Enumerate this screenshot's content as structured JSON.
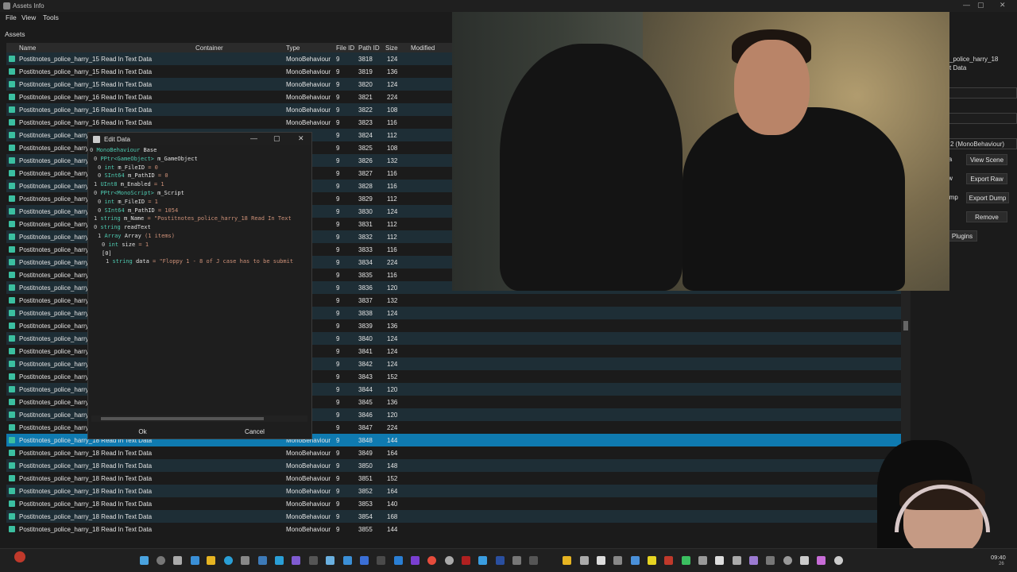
{
  "window": {
    "title": "Assets Info",
    "controls": [
      "—",
      "▢",
      "✕"
    ]
  },
  "menu": [
    "File",
    "View",
    "Tools"
  ],
  "assets_label": "Assets",
  "columns": {
    "name": "Name",
    "container": "Container",
    "type": "Type",
    "file_id": "File ID",
    "path_id": "Path ID",
    "size": "Size",
    "modified": "Modified"
  },
  "rows": [
    {
      "name": "Postitnotes_police_harry_15 Read In Text Data",
      "type": "MonoBehaviour",
      "file_id": "9",
      "path_id": "3818",
      "size": "124"
    },
    {
      "name": "Postitnotes_police_harry_15 Read In Text Data",
      "type": "MonoBehaviour",
      "file_id": "9",
      "path_id": "3819",
      "size": "136"
    },
    {
      "name": "Postitnotes_police_harry_15 Read In Text Data",
      "type": "MonoBehaviour",
      "file_id": "9",
      "path_id": "3820",
      "size": "124"
    },
    {
      "name": "Postitnotes_police_harry_16 Read In Text Data",
      "type": "MonoBehaviour",
      "file_id": "9",
      "path_id": "3821",
      "size": "224"
    },
    {
      "name": "Postitnotes_police_harry_16 Read In Text Data",
      "type": "MonoBehaviour",
      "file_id": "9",
      "path_id": "3822",
      "size": "108"
    },
    {
      "name": "Postitnotes_police_harry_16 Read In Text Data",
      "type": "MonoBehaviour",
      "file_id": "9",
      "path_id": "3823",
      "size": "116"
    },
    {
      "name": "Postitnotes_police_harry",
      "type": "aviour",
      "file_id": "9",
      "path_id": "3824",
      "size": "112"
    },
    {
      "name": "Postitnotes_police_harry",
      "type": "aviour",
      "file_id": "9",
      "path_id": "3825",
      "size": "108"
    },
    {
      "name": "Postitnotes_police_harry",
      "type": "haviour",
      "file_id": "9",
      "path_id": "3826",
      "size": "132"
    },
    {
      "name": "Postitnotes_police_harry",
      "type": "haviour",
      "file_id": "9",
      "path_id": "3827",
      "size": "116"
    },
    {
      "name": "Postitnotes_police_harry",
      "type": "haviour",
      "file_id": "9",
      "path_id": "3828",
      "size": "116"
    },
    {
      "name": "Postitnotes_police_harry",
      "type": "aviour",
      "file_id": "9",
      "path_id": "3829",
      "size": "112"
    },
    {
      "name": "Postitnotes_police_harry",
      "type": "haviour",
      "file_id": "9",
      "path_id": "3830",
      "size": "124"
    },
    {
      "name": "Postitnotes_police_harry",
      "type": "aviour",
      "file_id": "9",
      "path_id": "3831",
      "size": "112"
    },
    {
      "name": "Postitnotes_police_harry",
      "type": "haviour",
      "file_id": "9",
      "path_id": "3832",
      "size": "112"
    },
    {
      "name": "Postitnotes_police_harry",
      "type": "aviour",
      "file_id": "9",
      "path_id": "3833",
      "size": "116"
    },
    {
      "name": "Postitnotes_police_harry",
      "type": "aviour",
      "file_id": "9",
      "path_id": "3834",
      "size": "224"
    },
    {
      "name": "Postitnotes_police_harry",
      "type": "haviour",
      "file_id": "9",
      "path_id": "3835",
      "size": "116"
    },
    {
      "name": "Postitnotes_police_harry",
      "type": "haviour",
      "file_id": "9",
      "path_id": "3836",
      "size": "120"
    },
    {
      "name": "Postitnotes_police_harry",
      "type": "aviour",
      "file_id": "9",
      "path_id": "3837",
      "size": "132"
    },
    {
      "name": "Postitnotes_police_harry",
      "type": "haviour",
      "file_id": "9",
      "path_id": "3838",
      "size": "124"
    },
    {
      "name": "Postitnotes_police_harry",
      "type": "haviour",
      "file_id": "9",
      "path_id": "3839",
      "size": "136"
    },
    {
      "name": "Postitnotes_police_harry",
      "type": "haviour",
      "file_id": "9",
      "path_id": "3840",
      "size": "124"
    },
    {
      "name": "Postitnotes_police_harry",
      "type": "haviour",
      "file_id": "9",
      "path_id": "3841",
      "size": "124"
    },
    {
      "name": "Postitnotes_police_harry",
      "type": "haviour",
      "file_id": "9",
      "path_id": "3842",
      "size": "124"
    },
    {
      "name": "Postitnotes_police_harry",
      "type": "aviour",
      "file_id": "9",
      "path_id": "3843",
      "size": "152"
    },
    {
      "name": "Postitnotes_police_harry",
      "type": "haviour",
      "file_id": "9",
      "path_id": "3844",
      "size": "120"
    },
    {
      "name": "Postitnotes_police_harry",
      "type": "aviour",
      "file_id": "9",
      "path_id": "3845",
      "size": "136"
    },
    {
      "name": "Postitnotes_police_harry",
      "type": "haviour",
      "file_id": "9",
      "path_id": "3846",
      "size": "120"
    },
    {
      "name": "Postitnotes_police_harry",
      "type": "aviour",
      "file_id": "9",
      "path_id": "3847",
      "size": "224"
    },
    {
      "name": "Postitnotes_police_harry_18 Read In Text Data",
      "type": "MonoBehaviour",
      "file_id": "9",
      "path_id": "3848",
      "size": "144"
    },
    {
      "name": "Postitnotes_police_harry_18 Read In Text Data",
      "type": "MonoBehaviour",
      "file_id": "9",
      "path_id": "3849",
      "size": "164"
    },
    {
      "name": "Postitnotes_police_harry_18 Read In Text Data",
      "type": "MonoBehaviour",
      "file_id": "9",
      "path_id": "3850",
      "size": "148"
    },
    {
      "name": "Postitnotes_police_harry_18 Read In Text Data",
      "type": "MonoBehaviour",
      "file_id": "9",
      "path_id": "3851",
      "size": "152"
    },
    {
      "name": "Postitnotes_police_harry_18 Read In Text Data",
      "type": "MonoBehaviour",
      "file_id": "9",
      "path_id": "3852",
      "size": "164"
    },
    {
      "name": "Postitnotes_police_harry_18 Read In Text Data",
      "type": "MonoBehaviour",
      "file_id": "9",
      "path_id": "3853",
      "size": "140"
    },
    {
      "name": "Postitnotes_police_harry_18 Read In Text Data",
      "type": "MonoBehaviour",
      "file_id": "9",
      "path_id": "3854",
      "size": "168"
    },
    {
      "name": "Postitnotes_police_harry_18 Read In Text Data",
      "type": "MonoBehaviour",
      "file_id": "9",
      "path_id": "3855",
      "size": "144"
    }
  ],
  "selected_row": 30,
  "right_panel": {
    "name_field": "_police_harry_18",
    "name_field2": "t Data",
    "type_field": "2 (MonoBehaviour)",
    "buttons": {
      "view_scene": "View Scene",
      "export_raw": "Export Raw",
      "export_raw_clipped": "w",
      "export_dump": "Export Dump",
      "export_dump_clipped": "ump",
      "remove": "Remove",
      "plugins": "Plugins"
    }
  },
  "dialog": {
    "title": "Edit Data",
    "controls": [
      "—",
      "▢",
      "✕"
    ],
    "tree": [
      {
        "indent": 0,
        "flag": "0",
        "type": "MonoBehaviour",
        "name": "Base",
        "value": ""
      },
      {
        "indent": 1,
        "flag": "0",
        "type": "PPtr<GameObject>",
        "name": "m_GameObject",
        "value": ""
      },
      {
        "indent": 2,
        "flag": "0",
        "type": "int",
        "name": "m_FileID",
        "value": " = 0"
      },
      {
        "indent": 2,
        "flag": "0",
        "type": "SInt64",
        "name": "m_PathID",
        "value": " = 0"
      },
      {
        "indent": 1,
        "flag": "1",
        "type": "UInt8",
        "name": "m_Enabled",
        "value": " = 1"
      },
      {
        "indent": 1,
        "flag": "0",
        "type": "PPtr<MonoScript>",
        "name": "m_Script",
        "value": ""
      },
      {
        "indent": 2,
        "flag": "0",
        "type": "int",
        "name": "m_FileID",
        "value": " = 1"
      },
      {
        "indent": 2,
        "flag": "0",
        "type": "SInt64",
        "name": "m_PathID",
        "value": " = 1054"
      },
      {
        "indent": 1,
        "flag": "1",
        "type": "string",
        "name": "m_Name",
        "value": " = \"Postitnotes_police_harry_18 Read In Text"
      },
      {
        "indent": 1,
        "flag": "0",
        "type": "string",
        "name": "readText",
        "value": ""
      },
      {
        "indent": 2,
        "flag": "1",
        "type": "Array",
        "name": "Array",
        "value": " (1 items)"
      },
      {
        "indent": 3,
        "flag": "0",
        "type": "int",
        "name": "size",
        "value": " = 1"
      },
      {
        "indent": 3,
        "flag": "",
        "type": "",
        "name": "[0]",
        "value": ""
      },
      {
        "indent": 4,
        "flag": "1",
        "type": "string",
        "name": "data",
        "value": " = \"Floppy 1 - 8 of J case has to be submit"
      }
    ],
    "ok_label": "Ok",
    "cancel_label": "Cancel"
  },
  "taskbar": {
    "time": "09:40",
    "date": "26"
  }
}
